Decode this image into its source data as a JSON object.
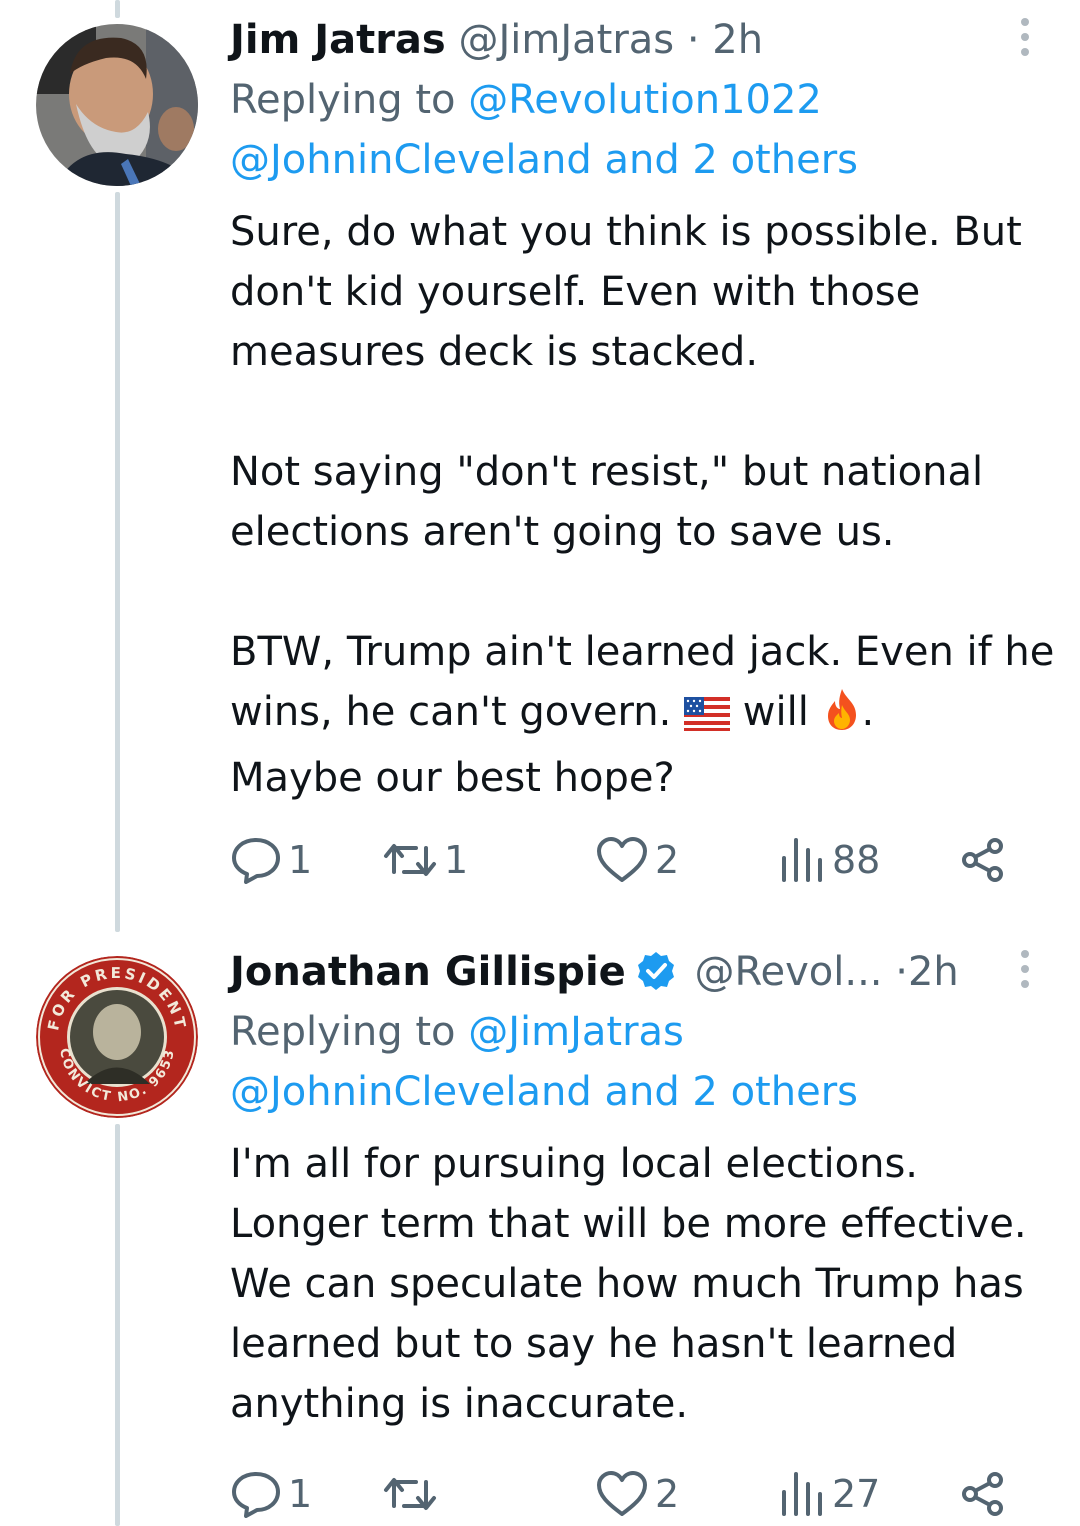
{
  "tweets": [
    {
      "display_name": "Jim Jatras",
      "handle": "@JimJatras",
      "separator": "·",
      "time": "2h",
      "verified": false,
      "replying_prefix": "Replying to",
      "replying_mention": "@Revolution1022",
      "replying_line2": "@JohninCleveland and 2 others",
      "paragraphs": [
        "Sure, do what you think is possible. But don't kid yourself. Even with those measures deck is stacked.",
        "Not saying \"don't resist,\" but national elections aren't going to save us."
      ],
      "last_para_parts": [
        "BTW, Trump ain't learned jack. Even if he wins, he can't govern. ",
        " will ",
        ".",
        "Maybe our best hope?"
      ],
      "emojis": [
        "us-flag-icon",
        "fire-icon"
      ],
      "stats": {
        "replies": "1",
        "retweets": "1",
        "likes": "2",
        "views": "88"
      }
    },
    {
      "display_name": "Jonathan Gillispie",
      "handle": "@Revol...",
      "separator": "·",
      "time": "2h",
      "verified": true,
      "replying_prefix": "Replying to",
      "replying_mention": "@JimJatras",
      "replying_line2": "@JohninCleveland and 2 others",
      "text": "I'm all for pursuing local elections. Longer term that will be more effective. We can speculate how much Trump has learned but to say he hasn't learned anything is inaccurate.",
      "avatar_badge_top": "FOR PRESIDENT",
      "avatar_badge_bottom": "CONVICT NO. 9653",
      "stats": {
        "replies": "1",
        "retweets": "",
        "likes": "2",
        "views": "27"
      }
    }
  ],
  "colors": {
    "link": "#1d9bf0",
    "secondary": "#536471",
    "thread_line": "#cfd9de",
    "verified": "#1d9bf0"
  }
}
